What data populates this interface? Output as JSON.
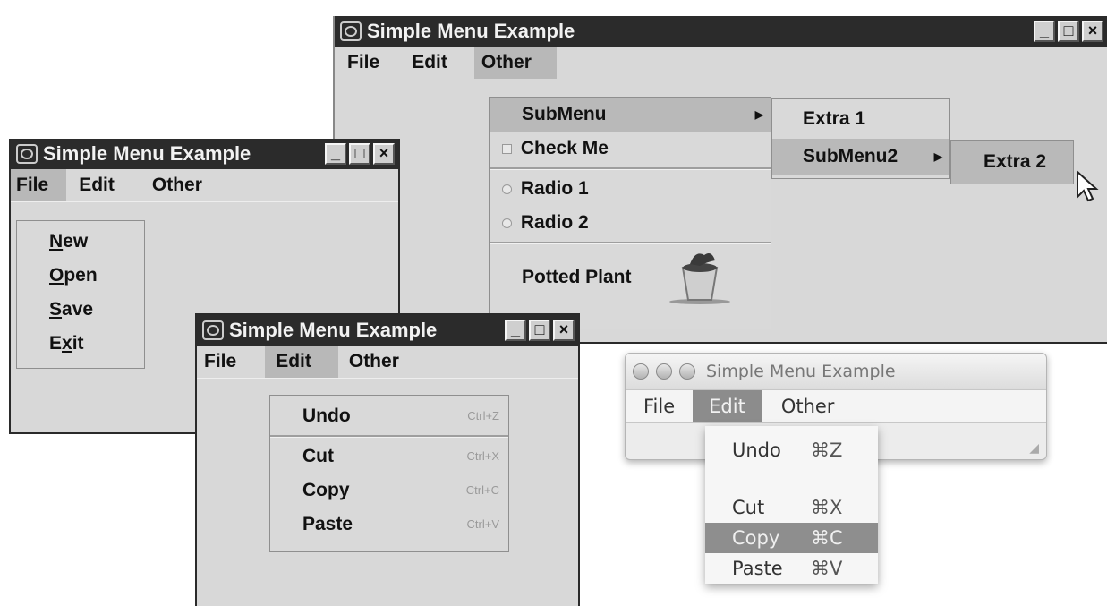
{
  "window_title": "Simple Menu Example",
  "menubar": {
    "file": "File",
    "edit": "Edit",
    "other": "Other"
  },
  "file_menu": {
    "new": "New",
    "open": "Open",
    "save": "Save",
    "exit": "Exit"
  },
  "edit_menu": {
    "undo": "Undo",
    "undo_accel": "Ctrl+Z",
    "cut": "Cut",
    "cut_accel": "Ctrl+X",
    "copy": "Copy",
    "copy_accel": "Ctrl+C",
    "paste": "Paste",
    "paste_accel": "Ctrl+V"
  },
  "other_menu": {
    "submenu": "SubMenu",
    "check_me": "Check Me",
    "radio1": "Radio 1",
    "radio2": "Radio 2",
    "potted_plant": "Potted Plant"
  },
  "submenu": {
    "extra1": "Extra 1",
    "submenu2": "SubMenu2"
  },
  "submenu2": {
    "extra2": "Extra 2"
  },
  "mac_edit_menu": {
    "undo": "Undo",
    "undo_key": "⌘Z",
    "cut": "Cut",
    "cut_key": "⌘X",
    "copy": "Copy",
    "copy_key": "⌘C",
    "paste": "Paste",
    "paste_key": "⌘V"
  }
}
